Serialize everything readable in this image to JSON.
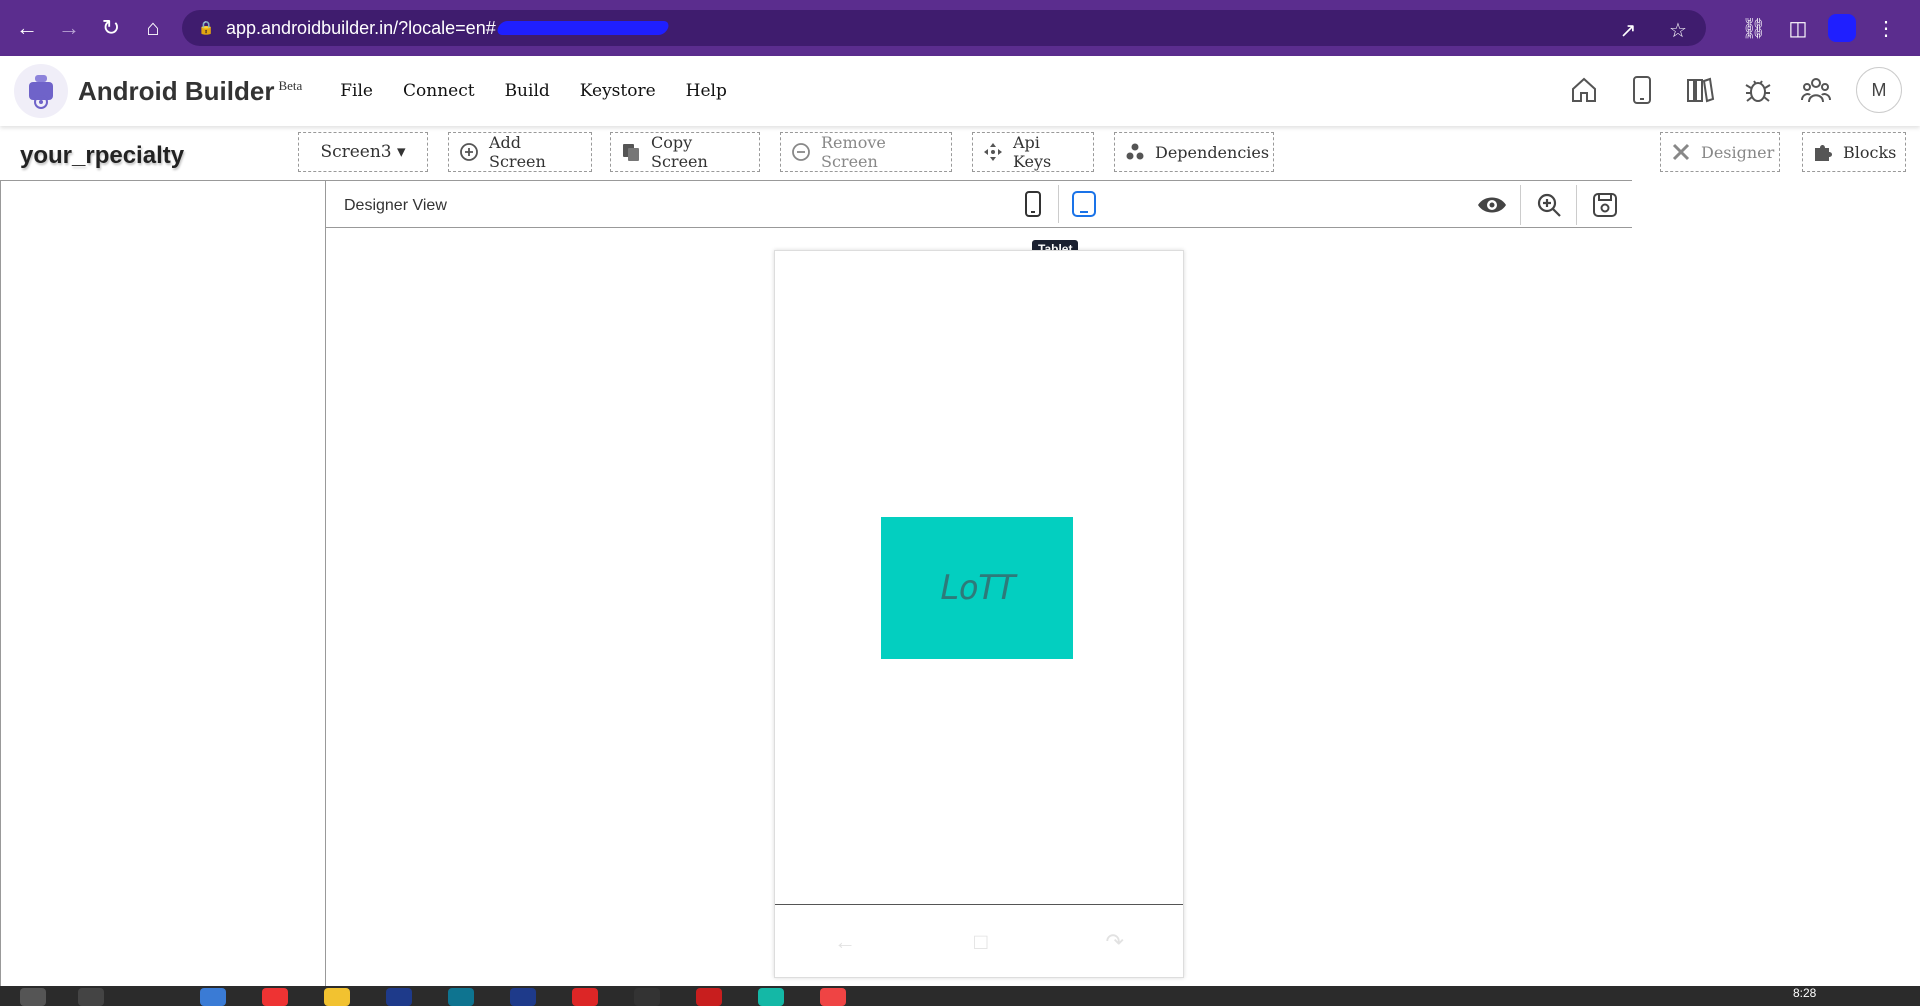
{
  "browser": {
    "url": "app.androidbuilder.in/?locale=en#"
  },
  "header": {
    "brand": "Android Builder",
    "badge": "Beta",
    "menu": [
      "File",
      "Connect",
      "Build",
      "Keystore",
      "Help"
    ],
    "avatar_initial": "M"
  },
  "toolbar": {
    "project_name": "your_rpecialty",
    "screen_select": "Screen3 ▾",
    "add_screen": "Add Screen",
    "copy_screen": "Copy Screen",
    "remove_screen": "Remove Screen",
    "api_keys": "Api Keys",
    "dependencies": "Dependencies",
    "designer": "Designer",
    "blocks": "Blocks"
  },
  "designer": {
    "title": "Designer View",
    "tooltip": "Tablet"
  },
  "canvas": {
    "image_text": "LoTT",
    "image_color": "#03cfc0"
  },
  "taskbar": {
    "clock": "8:28"
  },
  "colors": {
    "browser": "#5b2d8e",
    "accent_blue": "#1a73e8"
  }
}
